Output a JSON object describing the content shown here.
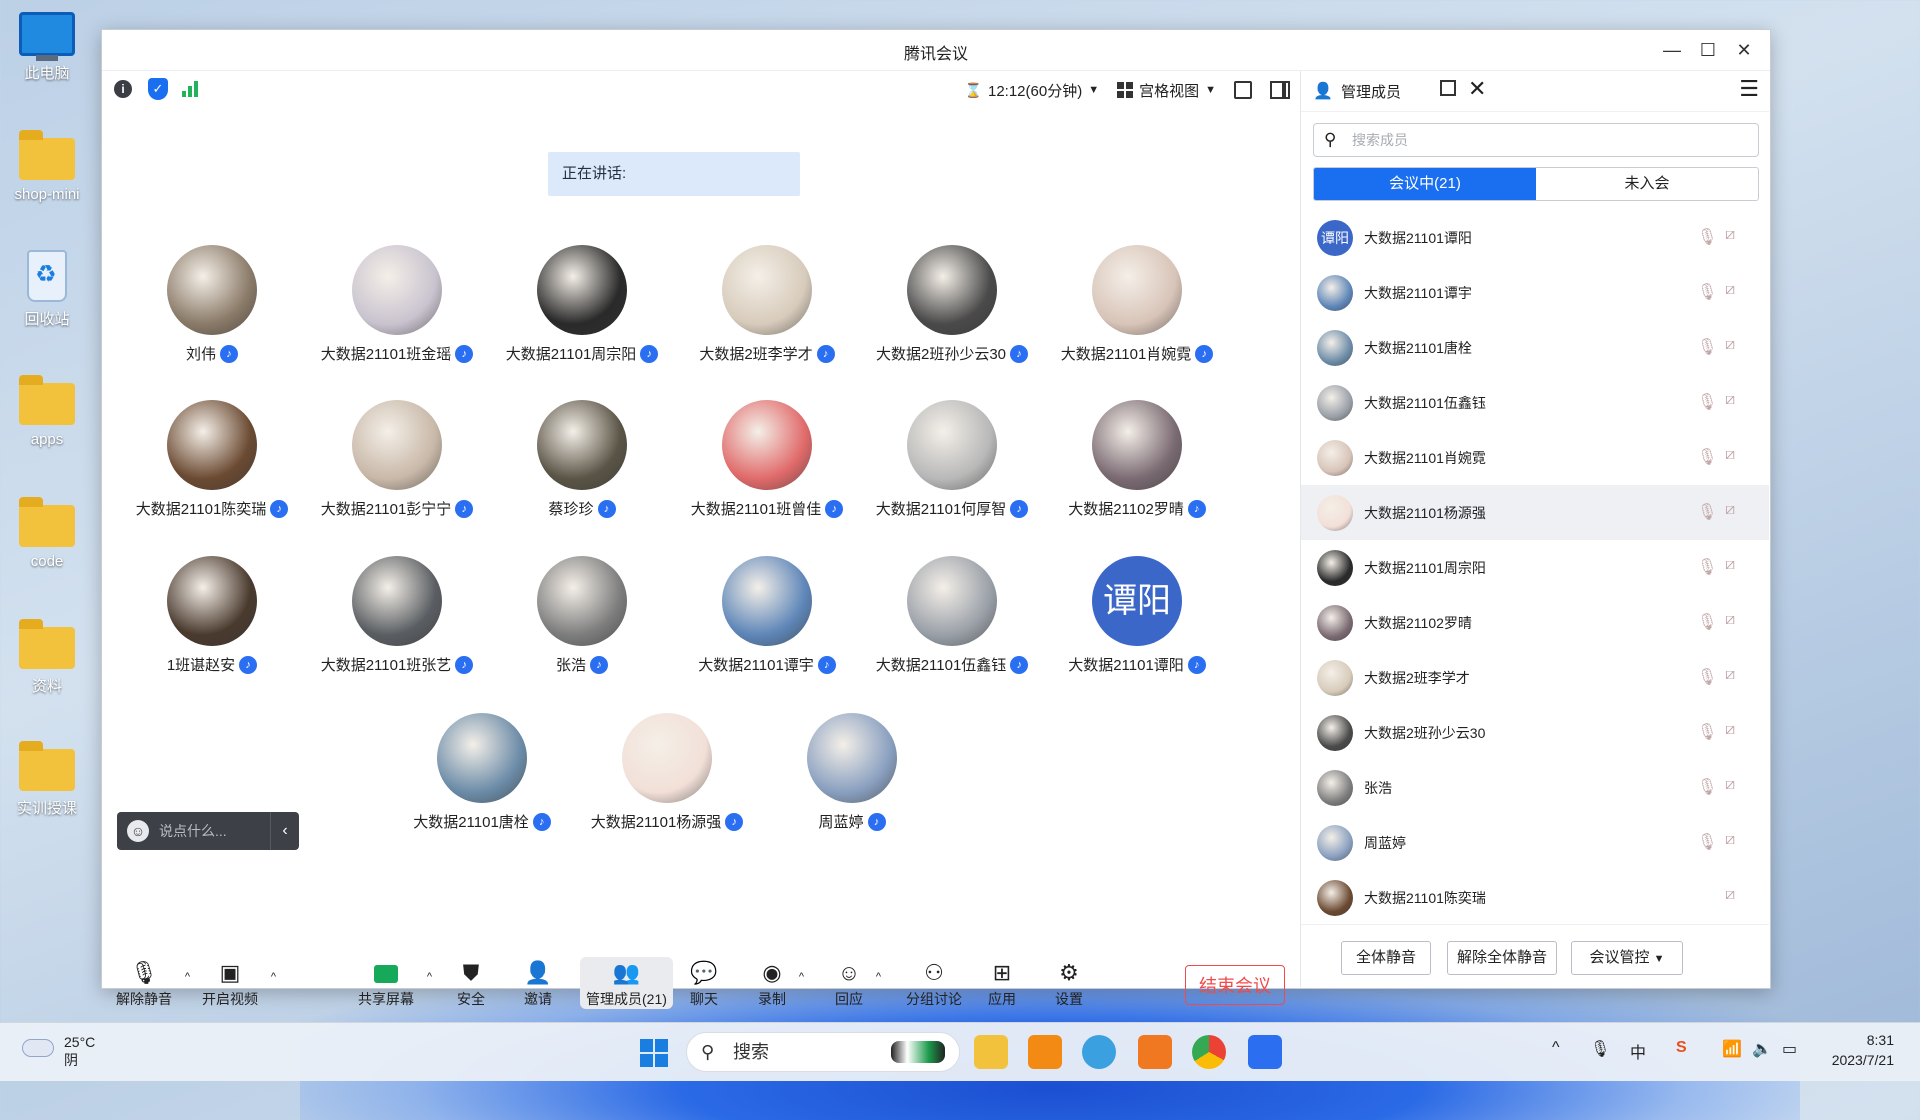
{
  "desktop": {
    "icons": [
      {
        "label": "此电脑",
        "icon": "computer-icon"
      },
      {
        "label": "shop-mini",
        "icon": "folder-icon"
      },
      {
        "label": "回收站",
        "icon": "recycle-bin-icon"
      },
      {
        "label": "apps",
        "icon": "folder-icon"
      },
      {
        "label": "code",
        "icon": "folder-icon"
      },
      {
        "label": "资料",
        "icon": "folder-icon"
      },
      {
        "label": "实训授课",
        "icon": "folder-icon"
      }
    ]
  },
  "window": {
    "title": "腾讯会议",
    "timer": "12:12(60分钟)",
    "view_mode": "宫格视图",
    "speaking_label": "正在讲话:"
  },
  "participants": [
    {
      "name": "刘伟",
      "avatar": "#8a7a68"
    },
    {
      "name": "大数据21101班金瑶",
      "avatar": "#c9c3cf"
    },
    {
      "name": "大数据21101周宗阳",
      "avatar": "#2a2a2a"
    },
    {
      "name": "大数据2班李学才",
      "avatar": "#d7cbbb"
    },
    {
      "name": "大数据2班孙少云30",
      "avatar": "#4a4a4a"
    },
    {
      "name": "大数据21101肖婉霓",
      "avatar": "#d8c4b8"
    },
    {
      "name": "大数据21101陈奕瑞",
      "avatar": "#6b4a32"
    },
    {
      "name": "大数据21101彭宁宁",
      "avatar": "#c8b8a8"
    },
    {
      "name": "蔡珍珍",
      "avatar": "#5a5446"
    },
    {
      "name": "大数据21101班曾佳",
      "avatar": "#e06a6a"
    },
    {
      "name": "大数据21101何厚智",
      "avatar": "#b8b8b8"
    },
    {
      "name": "大数据21102罗晴",
      "avatar": "#7a6a72"
    },
    {
      "name": "1班谌赵安",
      "avatar": "#4a3a2e"
    },
    {
      "name": "大数据21101班张艺",
      "avatar": "#5a5e62"
    },
    {
      "name": "张浩",
      "avatar": "#7d7d7d"
    },
    {
      "name": "大数据21101谭宇",
      "avatar": "#5e86b8"
    },
    {
      "name": "大数据21101伍鑫钰",
      "avatar": "#9aa0a8"
    },
    {
      "name": "大数据21101谭阳",
      "avatar": "text",
      "initials": "谭阳"
    },
    {
      "name": "大数据21101唐栓",
      "avatar": "#6c8ca8"
    },
    {
      "name": "大数据21101杨源强",
      "avatar": "#f2e0d8"
    },
    {
      "name": "周蓝婷",
      "avatar": "#8aa0c0"
    }
  ],
  "chat": {
    "placeholder": "说点什么..."
  },
  "toolbar": {
    "unmute": "解除静音",
    "start_video": "开启视频",
    "share_screen": "共享屏幕",
    "security": "安全",
    "invite": "邀请",
    "manage_members": "管理成员(21)",
    "chat": "聊天",
    "record": "录制",
    "reactions": "回应",
    "breakout": "分组讨论",
    "apps": "应用",
    "settings": "设置",
    "end_meeting": "结束会议"
  },
  "members_panel": {
    "title": "管理成员",
    "search_placeholder": "搜索成员",
    "tab_in_meeting": "会议中(21)",
    "tab_not_joined": "未入会",
    "members": [
      {
        "name": "大数据21101谭阳",
        "avatar": "text",
        "initials": "谭阳",
        "mic": true
      },
      {
        "name": "大数据21101谭宇",
        "avatar": "#5e86b8",
        "mic": true
      },
      {
        "name": "大数据21101唐栓",
        "avatar": "#6c8ca8",
        "mic": true
      },
      {
        "name": "大数据21101伍鑫钰",
        "avatar": "#9aa0a8",
        "mic": true
      },
      {
        "name": "大数据21101肖婉霓",
        "avatar": "#d8c4b8",
        "mic": true
      },
      {
        "name": "大数据21101杨源强",
        "avatar": "#f2e0d8",
        "mic": true
      },
      {
        "name": "大数据21101周宗阳",
        "avatar": "#2a2a2a",
        "mic": true
      },
      {
        "name": "大数据21102罗晴",
        "avatar": "#7a6a72",
        "mic": true
      },
      {
        "name": "大数据2班李学才",
        "avatar": "#d7cbbb",
        "mic": true
      },
      {
        "name": "大数据2班孙少云30",
        "avatar": "#4a4a4a",
        "mic": true
      },
      {
        "name": "张浩",
        "avatar": "#7d7d7d",
        "mic": true
      },
      {
        "name": "周蓝婷",
        "avatar": "#8aa0c0",
        "mic": true
      },
      {
        "name": "大数据21101陈奕瑞",
        "avatar": "#6b4a32",
        "mic": false
      }
    ],
    "mute_all": "全体静音",
    "unmute_all": "解除全体静音",
    "meeting_control": "会议管控"
  },
  "taskbar": {
    "temperature": "25°C",
    "weather": "阴",
    "search": "搜索",
    "ime": "中",
    "time": "8:31",
    "date": "2023/7/21"
  },
  "colors": {
    "accent": "#1a6ff0",
    "end_meeting": "#f04a4a",
    "signal": "#1fb35a"
  }
}
